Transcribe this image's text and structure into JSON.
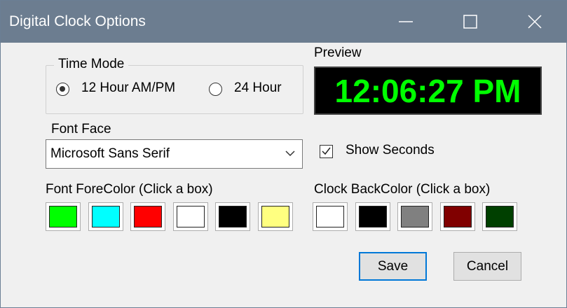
{
  "window": {
    "title": "Digital Clock Options"
  },
  "time_mode": {
    "legend": "Time Mode",
    "option_12": "12 Hour AM/PM",
    "option_24": "24 Hour",
    "selected": "12 Hour AM/PM"
  },
  "preview": {
    "label": "Preview",
    "time": "12:06:27 PM",
    "fore_color": "#00ff00",
    "back_color": "#000000"
  },
  "font_face": {
    "label": "Font Face",
    "value": "Microsoft Sans Serif"
  },
  "show_seconds": {
    "label": "Show Seconds",
    "checked": true
  },
  "fore_colors": {
    "label": "Font ForeColor (Click a box)",
    "swatches": [
      "#00ff00",
      "#00ffff",
      "#ff0000",
      "#ffffff",
      "#000000",
      "#ffff80"
    ]
  },
  "back_colors": {
    "label": "Clock BackColor (Click a box)",
    "swatches": [
      "#ffffff",
      "#000000",
      "#808080",
      "#800000",
      "#004000"
    ]
  },
  "buttons": {
    "save": "Save",
    "cancel": "Cancel"
  },
  "icons": {
    "minimize": "minimize-icon",
    "maximize": "maximize-icon",
    "close": "close-icon",
    "dropdown": "chevron-down-icon",
    "check": "check-icon"
  }
}
